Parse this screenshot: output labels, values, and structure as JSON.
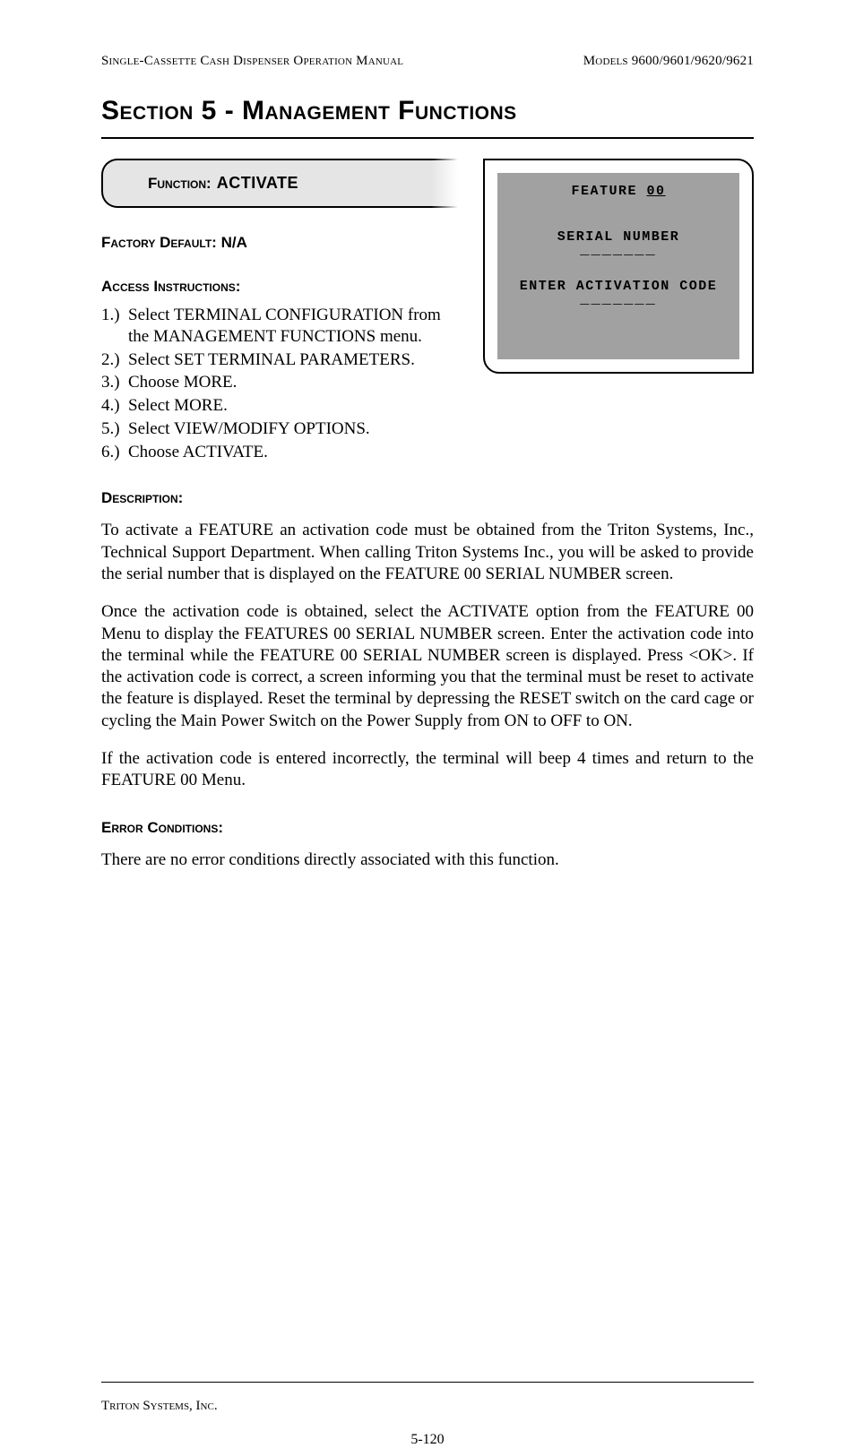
{
  "header": {
    "left": "Single-Cassette Cash Dispenser Operation Manual",
    "right": "Models 9600/9601/9620/9621"
  },
  "section_title": "Section 5 - Management Functions",
  "function_box": {
    "label": "Function:",
    "name": "ACTIVATE"
  },
  "screen": {
    "feature_prefix": "FEATURE ",
    "feature_num": "00",
    "serial_label": "SERIAL NUMBER",
    "serial_slots": "_______",
    "enter_label": "ENTER ACTIVATION CODE",
    "code_slots": "_______"
  },
  "factory_default": {
    "label": "Factory Default:",
    "value": "N/A"
  },
  "access": {
    "label": "Access Instructions:",
    "items": [
      "Select TERMINAL CONFIGURATION from the MANAGEMENT FUNCTIONS menu.",
      "Select SET TERMINAL PARAMETERS.",
      "Choose MORE.",
      "Select MORE.",
      "Select VIEW/MODIFY OPTIONS.",
      "Choose ACTIVATE."
    ]
  },
  "description": {
    "label": "Description:",
    "p1": "To activate a FEATURE  an activation code must be obtained from the Triton Systems, Inc., Technical Support Department.  When calling Triton Systems Inc., you will be asked to provide the serial number that is displayed on the FEATURE 00 SERIAL NUMBER screen.",
    "p2": "Once the activation code is obtained, select the ACTIVATE option from the FEATURE 00 Menu to display the FEATURES 00 SERIAL NUMBER screen.  Enter the activation code into the terminal while the FEATURE 00 SERIAL NUMBER screen is displayed.  Press <OK>.  If the activation code is correct, a screen informing you that the terminal must be reset to activate the feature is displayed.  Reset the terminal by depressing the RESET switch on the card cage or cycling the Main Power Switch on the Power Supply from ON to OFF to ON.",
    "p3": "If the activation code is entered incorrectly, the terminal will beep 4 times and return to the FEATURE 00 Menu."
  },
  "errors": {
    "label": "Error Conditions:",
    "text": "There are no error conditions directly associated with this function."
  },
  "footer": {
    "company": "Triton Systems, Inc.",
    "page": "5-120"
  }
}
